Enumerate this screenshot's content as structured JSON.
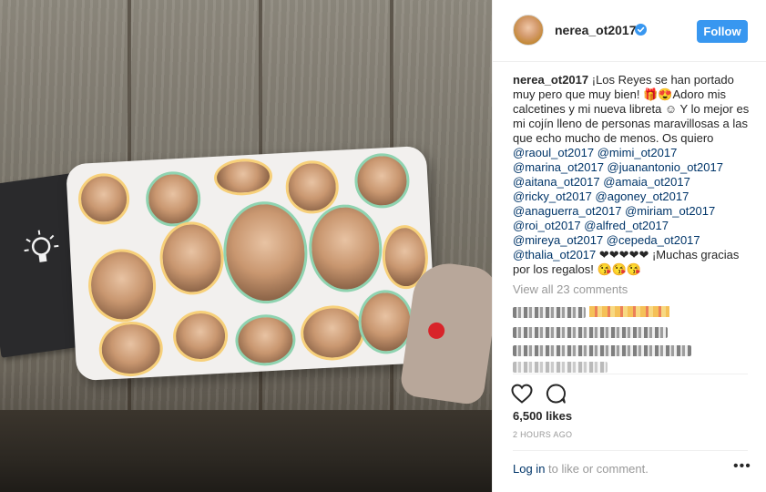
{
  "post": {
    "username": "nerea_ot2017",
    "follow_label": "Follow",
    "caption_text": "¡Los Reyes se han portado muy pero que muy bien! 🎁😍Adoro mis calcetines y mi nueva libreta ☺ Y lo mejor es mi cojín lleno de personas maravillosas a las que echo mucho de menos. Os quiero",
    "mentions": [
      "@raoul_ot2017 @mimi_ot2017",
      "@marina_ot2017 @juanantonio_ot2017",
      "@aitana_ot2017 @amaia_ot2017",
      "@ricky_ot2017 @agoney_ot2017",
      "@anaguerra_ot2017 @miriam_ot2017",
      "@roi_ot2017 @alfred_ot2017",
      "@mireya_ot2017 @cepeda_ot2017"
    ],
    "last_mention": "@thalia_ot2017",
    "caption_tail": " ❤❤❤❤❤ ¡Muchas gracias por los regalos! 😘😘😘",
    "view_all_comments": "View all 23 comments",
    "likes": "6,500 likes",
    "time_ago": "2 HOURS AGO",
    "login_link": "Log in",
    "login_rest": " to like or comment.",
    "more_options": "•••"
  },
  "icons": {
    "verified": "verified-badge-icon",
    "heart": "heart-outline-icon",
    "comment": "comment-bubble-icon",
    "more": "more-options-icon"
  },
  "colors": {
    "accent": "#3897f0",
    "link": "#003569",
    "muted": "#999999"
  }
}
